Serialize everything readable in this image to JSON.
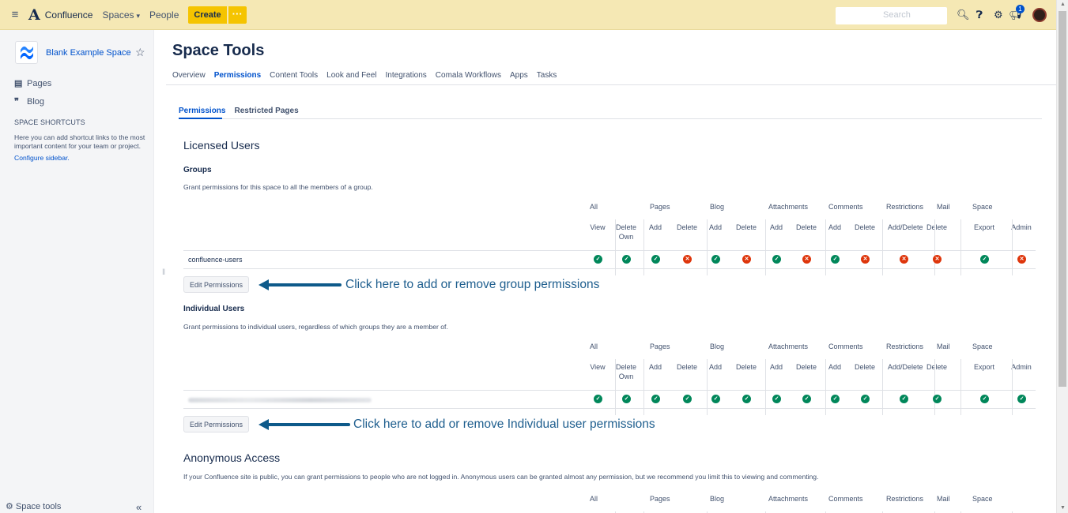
{
  "topbar": {
    "brand": "Confluence",
    "spaces": "Spaces",
    "people": "People",
    "create": "Create",
    "more": "···",
    "search_placeholder": "Search",
    "notification_count": "1"
  },
  "sidebar": {
    "space_name": "Blank Example Space",
    "items": [
      {
        "label": "Pages",
        "icon": "pages-icon"
      },
      {
        "label": "Blog",
        "icon": "blog-quote-icon"
      }
    ],
    "shortcuts_title": "SPACE SHORTCUTS",
    "shortcuts_text": "Here you can add shortcut links to the most important content for your team or project.",
    "configure_link": "Configure sidebar.",
    "space_tools": "Space tools"
  },
  "main": {
    "title": "Space Tools",
    "tabs": [
      "Overview",
      "Permissions",
      "Content Tools",
      "Look and Feel",
      "Integrations",
      "Comala Workflows",
      "Apps",
      "Tasks"
    ],
    "active_tab": "Permissions",
    "subtabs": [
      "Permissions",
      "Restricted Pages"
    ],
    "licensed_users": "Licensed Users",
    "groups_title": "Groups",
    "groups_desc": "Grant permissions for this space to all the members of a group.",
    "individual_title": "Individual Users",
    "individual_desc": "Grant permissions to individual users, regardless of which groups they are a member of.",
    "edit_permissions": "Edit Permissions",
    "callout_group": "Click here to add or remove group permissions",
    "callout_individual": "Click here to add or remove Individual user permissions",
    "anonymous_title": "Anonymous Access",
    "anonymous_desc": "If your Confluence site is public, you can grant permissions to people who are not logged in. Anonymous users can be granted almost any permission, but we recommend you limit this to viewing and commenting."
  },
  "table": {
    "categories": [
      "All",
      "Pages",
      "Blog",
      "Attachments",
      "Comments",
      "Restrictions",
      "Mail",
      "Space"
    ],
    "columns": [
      "View",
      "Delete Own",
      "Add",
      "Delete",
      "Add",
      "Delete",
      "Add",
      "Delete",
      "Add",
      "Delete",
      "Add/Delete",
      "Delete",
      "Export",
      "Admin"
    ],
    "group_row": {
      "name": "confluence-users",
      "values": [
        true,
        true,
        true,
        false,
        true,
        false,
        true,
        false,
        true,
        false,
        false,
        false,
        true,
        false
      ]
    },
    "individual_row": {
      "values": [
        true,
        true,
        true,
        true,
        true,
        true,
        true,
        true,
        true,
        true,
        true,
        true,
        true,
        true
      ]
    }
  },
  "colors": {
    "topbar": "#f5e8b4",
    "create": "#f5c400",
    "link": "#0052cc",
    "granted": "#00875a",
    "denied": "#de350b",
    "callout": "#1e5e8e"
  }
}
